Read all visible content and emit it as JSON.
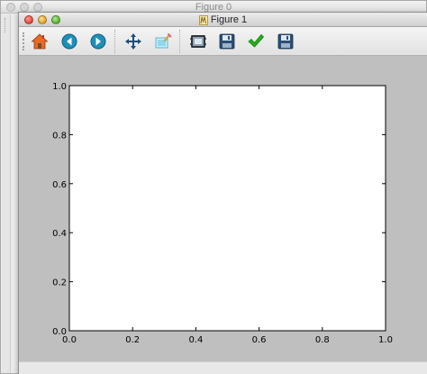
{
  "back_window": {
    "title": "Figure 0"
  },
  "window": {
    "title": "Figure 1",
    "controls": [
      "close",
      "minimize",
      "zoom"
    ]
  },
  "toolbar": {
    "buttons": [
      {
        "icon": "home-icon",
        "tooltip": "Home"
      },
      {
        "icon": "back-arrow-icon",
        "tooltip": "Back"
      },
      {
        "icon": "forward-arrow-icon",
        "tooltip": "Forward"
      },
      {
        "icon": "pan-move-icon",
        "tooltip": "Pan"
      },
      {
        "icon": "zoom-rect-icon",
        "tooltip": "Zoom"
      },
      {
        "icon": "subplots-icon",
        "tooltip": "Subplots"
      },
      {
        "icon": "save-icon",
        "tooltip": "Save"
      },
      {
        "icon": "checkmark-icon",
        "tooltip": "Edit"
      },
      {
        "icon": "save-as-icon",
        "tooltip": "Save as"
      }
    ]
  },
  "colors": {
    "figure_bg": "#bfbfbf",
    "axes_bg": "#ffffff",
    "icon_teal": "#1e8fb8",
    "icon_green": "#22b21a",
    "icon_navy": "#2a4f78"
  },
  "chart_data": {
    "type": "scatter",
    "series": [],
    "xlim": [
      0.0,
      1.0
    ],
    "ylim": [
      0.0,
      1.0
    ],
    "xticks": [
      "0.0",
      "0.2",
      "0.4",
      "0.6",
      "0.8",
      "1.0"
    ],
    "yticks": [
      "0.0",
      "0.2",
      "0.4",
      "0.6",
      "0.8",
      "1.0"
    ],
    "xtick_values": [
      0.0,
      0.2,
      0.4,
      0.6,
      0.8,
      1.0
    ],
    "ytick_values": [
      0.0,
      0.2,
      0.4,
      0.6,
      0.8,
      1.0
    ],
    "grid": false
  }
}
